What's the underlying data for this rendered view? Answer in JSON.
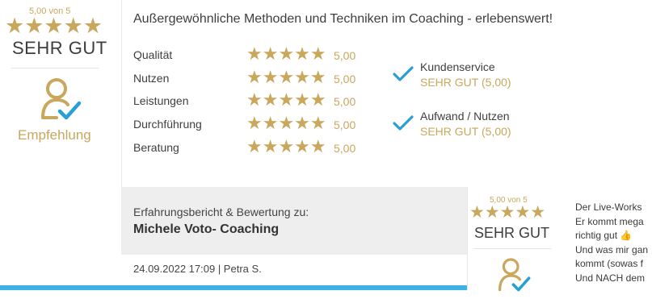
{
  "summary": {
    "score_text": "5,00 von 5",
    "stars": "★★★★★",
    "verdict": "SEHR GUT",
    "badge_label": "Empfehlung",
    "badge_icon": "person-check-icon"
  },
  "review": {
    "title": "Außergewöhnliche Methoden und Techniken im Coaching - erlebenswert!",
    "criteria": [
      {
        "label": "Qualität",
        "stars": "★★★★★",
        "score": "5,00"
      },
      {
        "label": "Nutzen",
        "stars": "★★★★★",
        "score": "5,00"
      },
      {
        "label": "Leistungen",
        "stars": "★★★★★",
        "score": "5,00"
      },
      {
        "label": "Durchführung",
        "stars": "★★★★★",
        "score": "5,00"
      },
      {
        "label": "Beratung",
        "stars": "★★★★★",
        "score": "5,00"
      }
    ],
    "checks": [
      {
        "title": "Kundenservice",
        "value": "SEHR GUT (5,00)"
      },
      {
        "title": "Aufwand / Nutzen",
        "value": "SEHR GUT (5,00)"
      }
    ]
  },
  "next_review": {
    "intro": "Erfahrungsbericht & Bewertung zu:",
    "subject": "Michele Voto- Coaching",
    "meta": "24.09.2022 17:09 | Petra S.",
    "mini_score_text": "5,00 von 5",
    "mini_stars": "★★★★★",
    "mini_verdict": "SEHR GUT",
    "excerpt_lines": [
      "Der Live-Works",
      "Er kommt mega",
      "richtig gut 👍",
      "Und was mir gan",
      "kommt (sowas f",
      "Und NACH dem"
    ]
  },
  "colors": {
    "gold": "#c9a75c",
    "check_blue": "#2a9fd6",
    "accent_bar": "#3bb3e8",
    "band_gray": "#eeeeee"
  }
}
